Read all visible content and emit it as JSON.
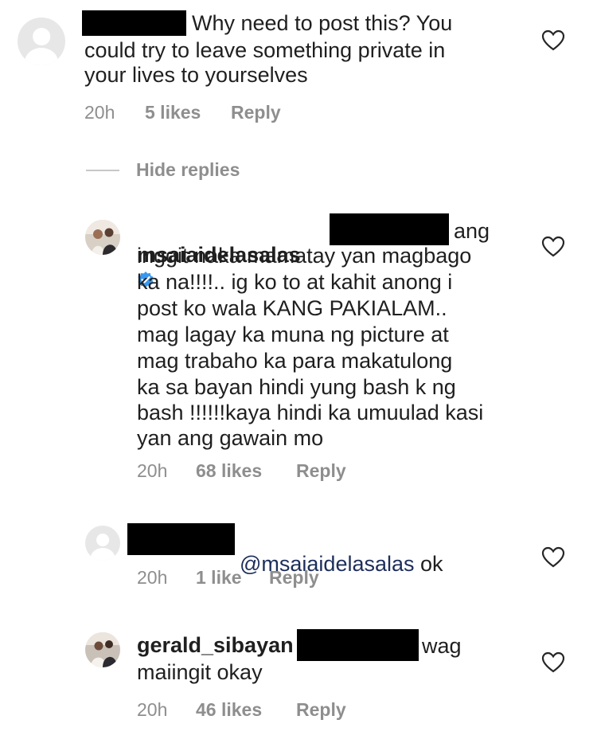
{
  "comments": [
    {
      "text_lines": [
        "Why need to post this? You",
        "could try to leave something private in",
        "your lives to yourselves"
      ],
      "meta": {
        "time": "20h",
        "likes": "5 likes",
        "reply": "Reply"
      }
    },
    {
      "username": "msaiaidelasalas",
      "verified": true,
      "text_after_redaction": "ang",
      "text_lines": [
        "inggit naka mamatay yan magbago",
        "ka na!!!!.. ig ko to at kahit anong i",
        "post ko wala KANG PAKIALAM..",
        "mag lagay ka muna ng picture at",
        "mag trabaho ka para makatulong",
        "ka sa bayan hindi yung bash k ng",
        "bash !!!!!!kaya hindi ka umuulad kasi",
        "yan ang gawain mo"
      ],
      "meta": {
        "time": "20h",
        "likes": "68 likes",
        "reply": "Reply"
      }
    },
    {
      "mention": "@msaiaidelasalas",
      "text": "ok",
      "meta": {
        "time": "20h",
        "likes": "1 like",
        "reply": "Reply"
      }
    },
    {
      "username": "gerald_sibayan",
      "text_after_redaction": "wag",
      "text_lines": [
        "maiingit okay"
      ],
      "meta": {
        "time": "20h",
        "likes": "46 likes",
        "reply": "Reply"
      }
    }
  ],
  "hide_replies_label": "Hide replies",
  "icons": {
    "like": "heart-icon",
    "avatar": "default-avatar-icon",
    "verified": "verified-badge-icon"
  }
}
